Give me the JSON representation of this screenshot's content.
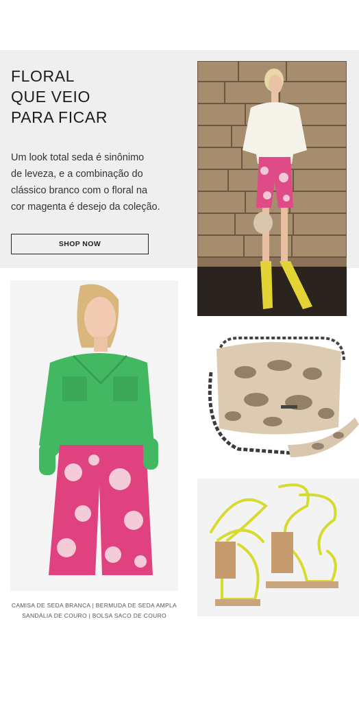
{
  "hero": {
    "title": "FLORAL\nQUE VEIO\nPARA FICAR",
    "description": "Um look total seda é sinônimo\nde leveza, e a combinação do\nclássico branco com o floral na\ncor magenta é desejo da coleção.",
    "cta_label": "SHOP NOW"
  },
  "caption": {
    "line1": "CAMISA DE SEDA BRANCA | BERMUDA DE SEDA AMPLA",
    "line2": "SANDÁLIA DE COURO | BOLSA SACO DE COURO"
  },
  "colors": {
    "band_bg": "#efefef",
    "magenta": "#e0417f",
    "green_shirt": "#3fb35f",
    "sandal_yellow": "#d9de3a",
    "snake_beige": "#d8c7ac"
  },
  "images": {
    "street_photo": "woman-white-shirt-floral-shorts-photo",
    "model_photo": "model-green-shirt-pink-floral-shorts-photo",
    "bag_photo": "snakeskin-bucket-bag-photo",
    "sandal_photo": "yellow-strappy-sandals-photo"
  }
}
